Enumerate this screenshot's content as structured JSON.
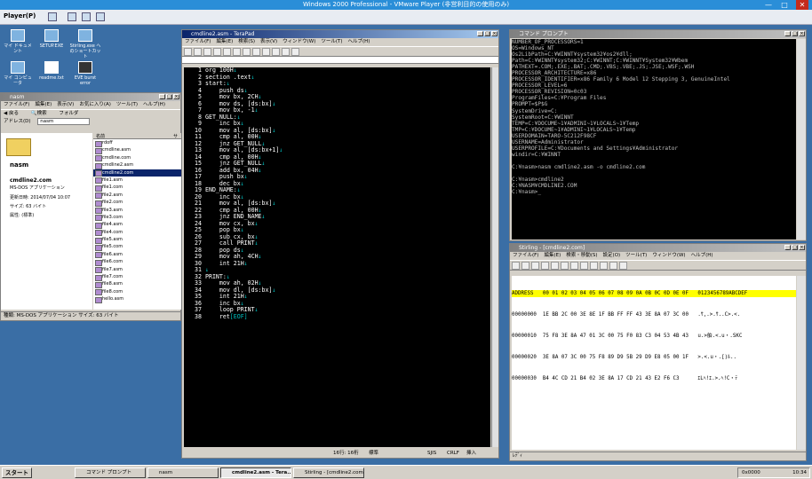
{
  "host": {
    "title": "Windows 2000 Professional - VMware Player (非営利目的の使用のみ)",
    "menu": "Player(P)",
    "minimize": "—",
    "maximize": "□",
    "close": "✕"
  },
  "desktop_icons": [
    {
      "label": "マイ ドキュメント"
    },
    {
      "label": "SETUP.EXE"
    },
    {
      "label": "Stirling.exe へのショートカット"
    },
    {
      "label": "マイ コンピュータ"
    },
    {
      "label": "readme.txt"
    },
    {
      "label": "EVE burst error"
    }
  ],
  "explorer": {
    "title": "nasm",
    "menu": [
      "ファイル(F)",
      "編集(E)",
      "表示(V)",
      "お気に入り(A)",
      "ツール(T)",
      "ヘルプ(H)"
    ],
    "back": "戻る",
    "search": "検索",
    "folders": "フォルダ",
    "address_label": "アドレス(D)",
    "address_value": "nasm",
    "folder_name": "nasm",
    "selected_file": "cmdline2.com",
    "file_type": "MS-DOS アプリケーション",
    "modified": "更新日時: 2014/07/04 10:07",
    "size": "サイズ: 63 バイト",
    "attr": "属性: (標準)",
    "col_name": "名前",
    "col_size": "サ",
    "files": [
      {
        "name": "rdoff",
        "size": ""
      },
      {
        "name": "cmdline.asm",
        "size": "1"
      },
      {
        "name": "cmdline.com",
        "size": "1"
      },
      {
        "name": "cmdline2.asm",
        "size": "1"
      },
      {
        "name": "cmdline2.com",
        "size": "1"
      },
      {
        "name": "file1.asm",
        "size": "1"
      },
      {
        "name": "file1.com",
        "size": "1"
      },
      {
        "name": "file2.asm",
        "size": "1"
      },
      {
        "name": "file2.com",
        "size": "1"
      },
      {
        "name": "file3.asm",
        "size": "1"
      },
      {
        "name": "file3.com",
        "size": "1"
      },
      {
        "name": "file4.asm",
        "size": "1"
      },
      {
        "name": "file4.com",
        "size": "1"
      },
      {
        "name": "file5.asm",
        "size": "1"
      },
      {
        "name": "file5.com",
        "size": "1"
      },
      {
        "name": "file6.asm",
        "size": "1"
      },
      {
        "name": "file6.com",
        "size": "1"
      },
      {
        "name": "file7.asm",
        "size": "1"
      },
      {
        "name": "file7.com",
        "size": "1"
      },
      {
        "name": "file8.asm",
        "size": "1"
      },
      {
        "name": "file8.com",
        "size": "1"
      },
      {
        "name": "hello.asm",
        "size": "1"
      }
    ],
    "status": "種類: MS-DOS アプリケーション サイズ: 63 バイト"
  },
  "terapad": {
    "title": "cmdline2.asm - TeraPad",
    "menu": [
      "ファイル(F)",
      "編集(E)",
      "検索(S)",
      "表示(V)",
      "ウィンドウ(W)",
      "ツール(T)",
      "ヘルプ(H)"
    ],
    "lines": [
      {
        "n": "1",
        "t": "org 100H",
        "cr": "↓"
      },
      {
        "n": "2",
        "t": "section .text",
        "cr": "↓"
      },
      {
        "n": "3",
        "t": "start:",
        "cr": "↓"
      },
      {
        "n": "4",
        "t": "    push ds",
        "cr": "↓"
      },
      {
        "n": "5",
        "t": "    mov bx, 2CH",
        "cr": "↓"
      },
      {
        "n": "6",
        "t": "    mov ds, [ds:bx]",
        "cr": "↓"
      },
      {
        "n": "7",
        "t": "    mov bx, -1",
        "cr": "↓"
      },
      {
        "n": "8",
        "t": "GET_NULL:",
        "cr": "↓"
      },
      {
        "n": "9",
        "t": "    inc bx",
        "cr": "↓"
      },
      {
        "n": "10",
        "t": "    mov al, [ds:bx]",
        "cr": "↓"
      },
      {
        "n": "11",
        "t": "    cmp al, 00H",
        "cr": "↓"
      },
      {
        "n": "12",
        "t": "    jnz GET_NULL",
        "cr": "↓"
      },
      {
        "n": "13",
        "t": "    mov al, [ds:bx+1]",
        "cr": "↓"
      },
      {
        "n": "14",
        "t": "    cmp al, 00H",
        "cr": "↓"
      },
      {
        "n": "15",
        "t": "    jnz GET_NULL",
        "cr": "↓"
      },
      {
        "n": "16",
        "t": "    add bx, 04H",
        "cr": "↓"
      },
      {
        "n": "17",
        "t": "    push bx",
        "cr": "↓"
      },
      {
        "n": "18",
        "t": "    dec bx",
        "cr": "↓"
      },
      {
        "n": "19",
        "t": "END_NAME:",
        "cr": "↓"
      },
      {
        "n": "20",
        "t": "    inc bx",
        "cr": "↓"
      },
      {
        "n": "21",
        "t": "    mov al, [ds:bx]",
        "cr": "↓"
      },
      {
        "n": "22",
        "t": "    cmp al, 00H",
        "cr": "↓"
      },
      {
        "n": "23",
        "t": "    jnz END_NAME",
        "cr": "↓"
      },
      {
        "n": "24",
        "t": "    mov cx, bx",
        "cr": "↓"
      },
      {
        "n": "25",
        "t": "    pop bx",
        "cr": "↓"
      },
      {
        "n": "26",
        "t": "    sub cx, bx",
        "cr": "↓"
      },
      {
        "n": "27",
        "t": "    call PRINT",
        "cr": "↓"
      },
      {
        "n": "28",
        "t": "    pop ds",
        "cr": "↓"
      },
      {
        "n": "29",
        "t": "    mov ah, 4CH",
        "cr": "↓"
      },
      {
        "n": "30",
        "t": "    int 21H",
        "cr": "↓"
      },
      {
        "n": "31",
        "t": "",
        "cr": "↓"
      },
      {
        "n": "32",
        "t": "PRINT:",
        "cr": "↓"
      },
      {
        "n": "33",
        "t": "    mov ah, 02H",
        "cr": "↓"
      },
      {
        "n": "34",
        "t": "    mov dl, [ds:bx]",
        "cr": "↓"
      },
      {
        "n": "35",
        "t": "    int 21H",
        "cr": "↓"
      },
      {
        "n": "36",
        "t": "    inc bx",
        "cr": "↓"
      },
      {
        "n": "37",
        "t": "    loop PRINT",
        "cr": "↓"
      },
      {
        "n": "38",
        "t": "    ret",
        "cr": "[EOF]"
      }
    ],
    "status_pos": "16行: 16桁",
    "status_mode": "標準",
    "status_enc": "SJIS",
    "status_eol": "CRLF",
    "status_ins": "挿入"
  },
  "cmd": {
    "title": "コマンド プロンプト",
    "text": "NUMBER_OF_PROCESSORS=1\nOS=Windows_NT\nOs2LibPath=C:¥WINNT¥system32¥os2¥dll;\nPath=C:¥WINNT¥system32;C:¥WINNT;C:¥WINNT¥System32¥Wbem\nPATHEXT=.COM;.EXE;.BAT;.CMD;.VBS;.VBE;.JS;.JSE;.WSF;.WSH\nPROCESSOR_ARCHITECTURE=x86\nPROCESSOR_IDENTIFIER=x86 Family 6 Model 12 Stepping 3, GenuineIntel\nPROCESSOR_LEVEL=6\nPROCESSOR_REVISION=0c03\nProgramFiles=C:¥Program Files\nPROMPT=$P$G\nSystemDrive=C:\nSystemRoot=C:¥WINNT\nTEMP=C:¥DOCUME~1¥ADMINI~1¥LOCALS~1¥Temp\nTMP=C:¥DOCUME~1¥ADMINI~1¥LOCALS~1¥Temp\nUSERDOMAIN=TARO-5C212F98CF\nUSERNAME=Administrator\nUSERPROFILE=C:¥Documents and Settings¥Administrator\nwindir=C:¥WINNT\n\nC:¥nasm>nasm cmdline2.asm -o cmdline2.com\n\nC:¥nasm>cmdline2\nC:¥NASM¥CMDLINE2.COM\nC:¥nasm>_"
  },
  "stirling": {
    "title": "Stirling - [cmdline2.com]",
    "menu": [
      "ファイル(F)",
      "編集(E)",
      "検索・移動(S)",
      "設定(O)",
      "ツール(T)",
      "ウィンドウ(W)",
      "ヘルプ(H)"
    ],
    "header": "ADDRESS   00 01 02 03 04 05 06 07 08 09 0A 0B 0C 0D 0E 0F   0123456789ABCDEF",
    "rows": [
      "00000000  1E BB 2C 00 3E 8E 1F BB FF FF 43 3E 8A 07 3C 00   .ｻ,.>.ｻ..C>.<.",
      "00000010  75 F8 3E 8A 47 01 3C 00 75 F0 83 C3 04 53 4B 43   u.>舶.<.u・.SKC",
      "00000020  3E 8A 07 3C 00 75 F8 89 D9 5B 29 D9 E8 05 00 1F   >.<.u・.[)ﾙ..",
      "00000030  B4 4C CD 21 B4 02 3E 8A 17 CD 21 43 E2 F6 C3      ｴLﾍ!ｴ.>.ﾍ!C・ﾃ"
    ],
    "status": "ﾚﾃﾞｨ",
    "status_addr": "0x0000"
  },
  "taskbar": {
    "start": "スタート",
    "tasks": [
      "コマンド プロンプト",
      "nasm",
      "cmdline2.asm - Tera...",
      "Stirling - [cmdline2.com]"
    ],
    "clock": "10:34"
  }
}
